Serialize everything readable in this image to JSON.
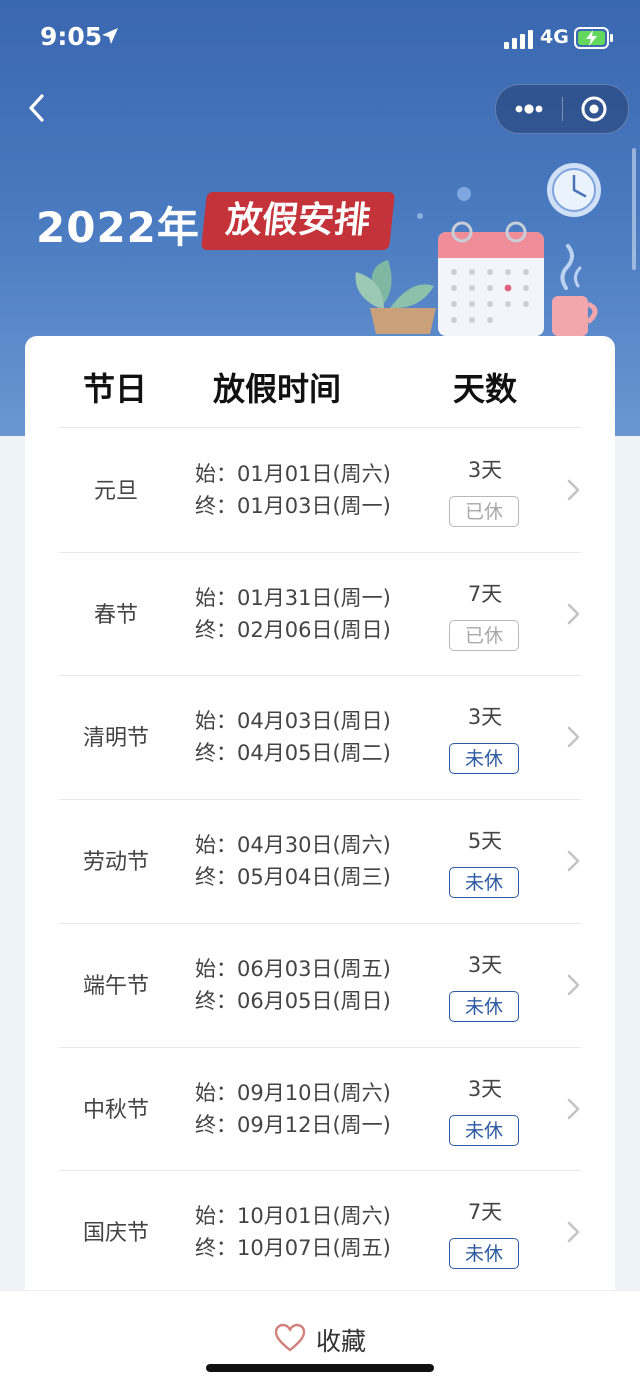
{
  "status": {
    "time": "9:05",
    "network": "4G"
  },
  "banner": {
    "year": "2022年",
    "tag": "放假安排"
  },
  "table": {
    "headers": [
      "节日",
      "放假时间",
      "天数"
    ],
    "start_prefix": "始：",
    "end_prefix": "终：",
    "rows": [
      {
        "name": "元旦",
        "start": "01月01日(周六)",
        "end": "01月03日(周一)",
        "days": "3天",
        "status": "已休"
      },
      {
        "name": "春节",
        "start": "01月31日(周一)",
        "end": "02月06日(周日)",
        "days": "7天",
        "status": "已休"
      },
      {
        "name": "清明节",
        "start": "04月03日(周日)",
        "end": "04月05日(周二)",
        "days": "3天",
        "status": "未休"
      },
      {
        "name": "劳动节",
        "start": "04月30日(周六)",
        "end": "05月04日(周三)",
        "days": "5天",
        "status": "未休"
      },
      {
        "name": "端午节",
        "start": "06月03日(周五)",
        "end": "06月05日(周日)",
        "days": "3天",
        "status": "未休"
      },
      {
        "name": "中秋节",
        "start": "09月10日(周六)",
        "end": "09月12日(周一)",
        "days": "3天",
        "status": "未休"
      },
      {
        "name": "国庆节",
        "start": "10月01日(周六)",
        "end": "10月07日(周五)",
        "days": "7天",
        "status": "未休"
      }
    ]
  },
  "bottom": {
    "favorite_label": "收藏"
  },
  "colors": {
    "header_blue": "#3a67b0",
    "tag_red": "#c4333a",
    "badge_blue": "#2d5aa0",
    "badge_gray": "#b8b8b8"
  },
  "icons": [
    "location-arrow-icon",
    "signal-icon",
    "battery-charging-icon",
    "back-chevron-icon",
    "more-dots-icon",
    "close-target-icon",
    "chevron-right-icon",
    "heart-icon"
  ]
}
